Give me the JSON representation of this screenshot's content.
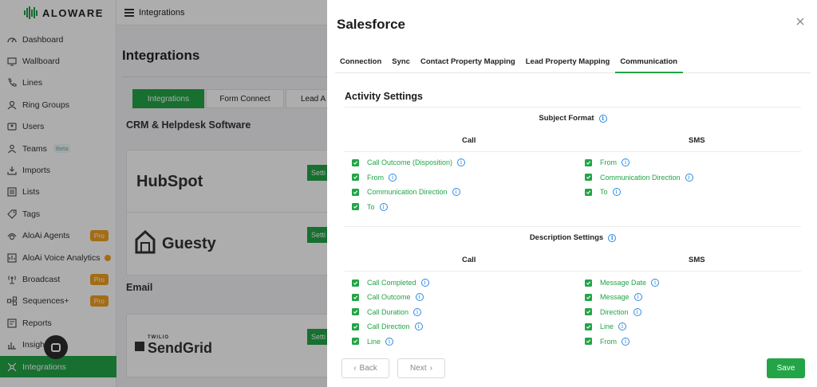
{
  "app": {
    "brand": "ALOWARE",
    "topbar_title": "Integrations",
    "nav": [
      {
        "label": "Dashboard",
        "icon": "dashboard-icon"
      },
      {
        "label": "Wallboard",
        "icon": "monitor-icon"
      },
      {
        "label": "Lines",
        "icon": "phone-icon"
      },
      {
        "label": "Ring Groups",
        "icon": "ring-groups-icon"
      },
      {
        "label": "Users",
        "icon": "users-icon"
      },
      {
        "label": "Teams",
        "icon": "teams-icon",
        "badge": "Beta"
      },
      {
        "label": "Imports",
        "icon": "import-icon"
      },
      {
        "label": "Lists",
        "icon": "list-icon"
      },
      {
        "label": "Tags",
        "icon": "tag-icon"
      },
      {
        "label": "AloAi Agents",
        "icon": "ai-agent-icon",
        "pro": "Pro"
      },
      {
        "label": "AloAi Voice Analytics",
        "icon": "voice-analytics-icon"
      },
      {
        "label": "Broadcast",
        "icon": "broadcast-icon",
        "pro": "Pro"
      },
      {
        "label": "Sequences+",
        "icon": "sequences-icon",
        "pro": "Pro"
      },
      {
        "label": "Reports",
        "icon": "reports-icon"
      },
      {
        "label": "Insigh",
        "icon": "insights-icon"
      },
      {
        "label": "Integrations",
        "icon": "integrations-icon",
        "active": true
      }
    ],
    "page_title": "Integrations",
    "int_tabs": [
      "Integrations",
      "Form Connect",
      "Lead A"
    ],
    "sections": {
      "crm": "CRM & Helpdesk Software",
      "email": "Email"
    },
    "cards": [
      {
        "brand": "HubSpot",
        "settings": "Setti"
      },
      {
        "brand": "Guesty",
        "settings": "Setti"
      },
      {
        "brand": "SendGrid",
        "settings": "Setti",
        "sub": "TWILIO"
      }
    ]
  },
  "drawer": {
    "title": "Salesforce",
    "tabs": [
      "Connection",
      "Sync",
      "Contact Property Mapping",
      "Lead Property Mapping",
      "Communication"
    ],
    "active_tab": "Communication",
    "activity_heading": "Activity Settings",
    "subject_format": {
      "label": "Subject Format",
      "call_header": "Call",
      "sms_header": "SMS",
      "call": [
        "Call Outcome (Disposition)",
        "From",
        "Communication Direction",
        "To"
      ],
      "sms": [
        "From",
        "Communication Direction",
        "To"
      ]
    },
    "description_settings": {
      "label": "Description Settings",
      "call_header": "Call",
      "sms_header": "SMS",
      "call": [
        "Call Completed",
        "Call Outcome",
        "Call Duration",
        "Call Direction",
        "Line"
      ],
      "sms": [
        "Message Date",
        "Message",
        "Direction",
        "Line",
        "From"
      ]
    },
    "buttons": {
      "back": "Back",
      "next": "Next",
      "save": "Save"
    }
  },
  "colors": {
    "accent": "#22a447",
    "info": "#2d8ae0",
    "pro": "#f0a020"
  }
}
